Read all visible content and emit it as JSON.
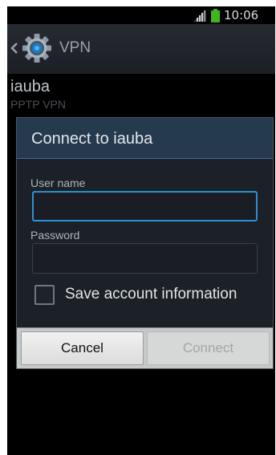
{
  "status_bar": {
    "time": "10:06",
    "icons": [
      "signal-icon",
      "battery-icon"
    ],
    "battery_color": "#3fb51f"
  },
  "action_bar": {
    "title": "VPN",
    "icons": [
      "back-chevron-icon",
      "settings-gear-icon"
    ]
  },
  "vpn_item": {
    "name": "iauba",
    "type": "PPTP VPN"
  },
  "dialog": {
    "title": "Connect to iauba",
    "username_label": "User name",
    "username_value": "",
    "password_label": "Password",
    "password_value": "",
    "save_label": "Save account information",
    "save_checked": false,
    "cancel_label": "Cancel",
    "connect_label": "Connect",
    "connect_enabled": false,
    "accent_color": "#2d8fd5"
  }
}
